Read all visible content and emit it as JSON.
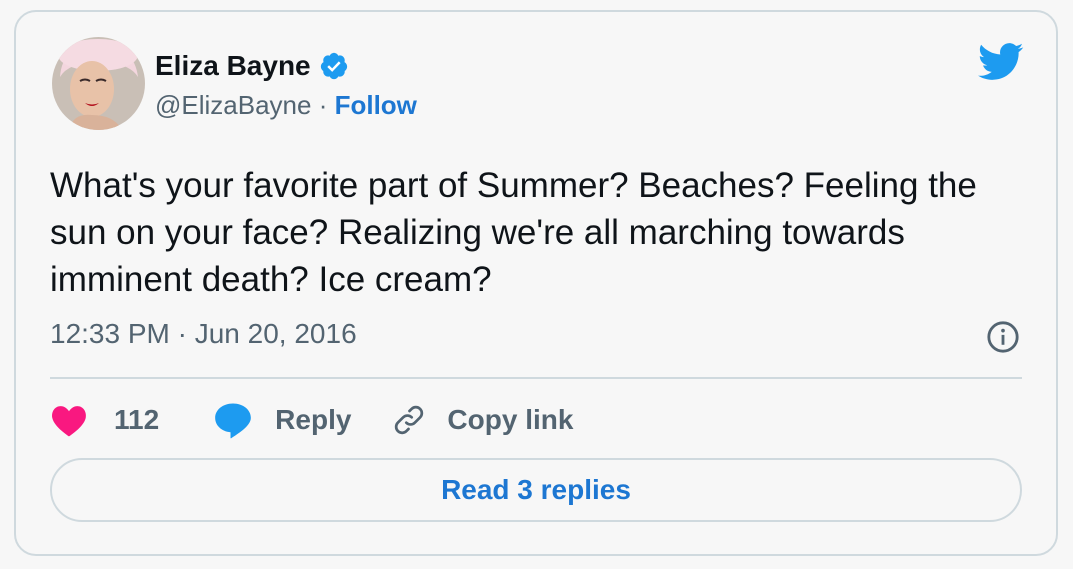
{
  "tweet": {
    "author_name": "Eliza Bayne",
    "handle": "@ElizaBayne",
    "separator": " · ",
    "follow_label": "Follow",
    "text": "What's your favorite part of Summer? Beaches? Feeling the sun on your face? Realizing we're all marching towards imminent death? Ice cream?",
    "timestamp": "12:33 PM · Jun 20, 2016",
    "like_count": "112",
    "reply_label": "Reply",
    "copy_link_label": "Copy link",
    "read_replies_label": "Read 3 replies"
  },
  "icons": {
    "verified": "verified-badge-icon",
    "brand": "twitter-bird-icon",
    "info": "info-icon",
    "like": "heart-icon",
    "reply": "speech-bubble-icon",
    "copy": "link-icon"
  },
  "colors": {
    "brand_blue": "#1d9bf0",
    "link_blue": "#1d77d2",
    "heart_pink": "#f91880",
    "secondary_text": "#536471",
    "border": "#cfd9de"
  }
}
